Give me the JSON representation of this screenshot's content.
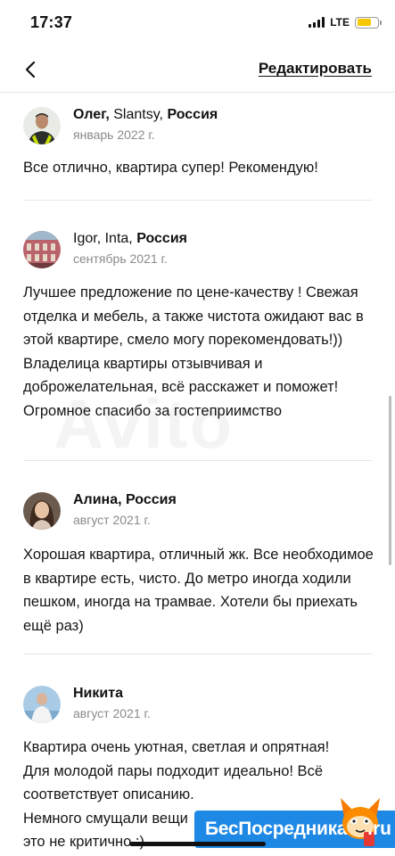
{
  "status_bar": {
    "time": "17:37",
    "network": "LTE",
    "battery_level": 0.7,
    "battery_color": "#f7c800"
  },
  "nav": {
    "back_icon": "chevron-left-icon",
    "edit_label": "Редактировать"
  },
  "reviews": [
    {
      "author_name": "Олег,",
      "author_city": "Slantsy,",
      "author_country": "Россия",
      "date": "январь 2022 г.",
      "text": "Все отлично, квартира супер! Рекомендую!"
    },
    {
      "author_name": "Igor,",
      "author_city": "Inta,",
      "author_country": "Россия",
      "date": "сентябрь 2021 г.",
      "text": "Лучшее предложение по цене-качеству ! Свежая отделка и мебель, а также чистота ожидают вас в этой квартире, смело могу порекомендовать!)) Владелица квартиры отзывчивая и доброжелательная, всё расскажет и поможет! Огромное спасибо за гостеприимство"
    },
    {
      "author_name": "Алина,",
      "author_city": "",
      "author_country": "Россия",
      "date": "август 2021 г.",
      "text": "Хорошая квартира, отличный жк. Все необходимое в квартире есть, чисто. До метро иногда ходили пешком, иногда на трамвае. Хотели бы приехать ещё раз)"
    },
    {
      "author_name": "Никита",
      "author_city": "",
      "author_country": "",
      "date": "август 2021 г.",
      "text_lines": [
        "Квартира очень уютная, светлая и опрятная!",
        "Для молодой пары подходит идеально! Всё",
        "соответствует описанию.",
        "Немного смущали вещи",
        "это не критично :)"
      ]
    }
  ],
  "watermarks": {
    "avito": "Avito",
    "banner_text": "БесПосредника",
    "banner_suffix": ".ru",
    "banner_color": "#1e88e5"
  }
}
